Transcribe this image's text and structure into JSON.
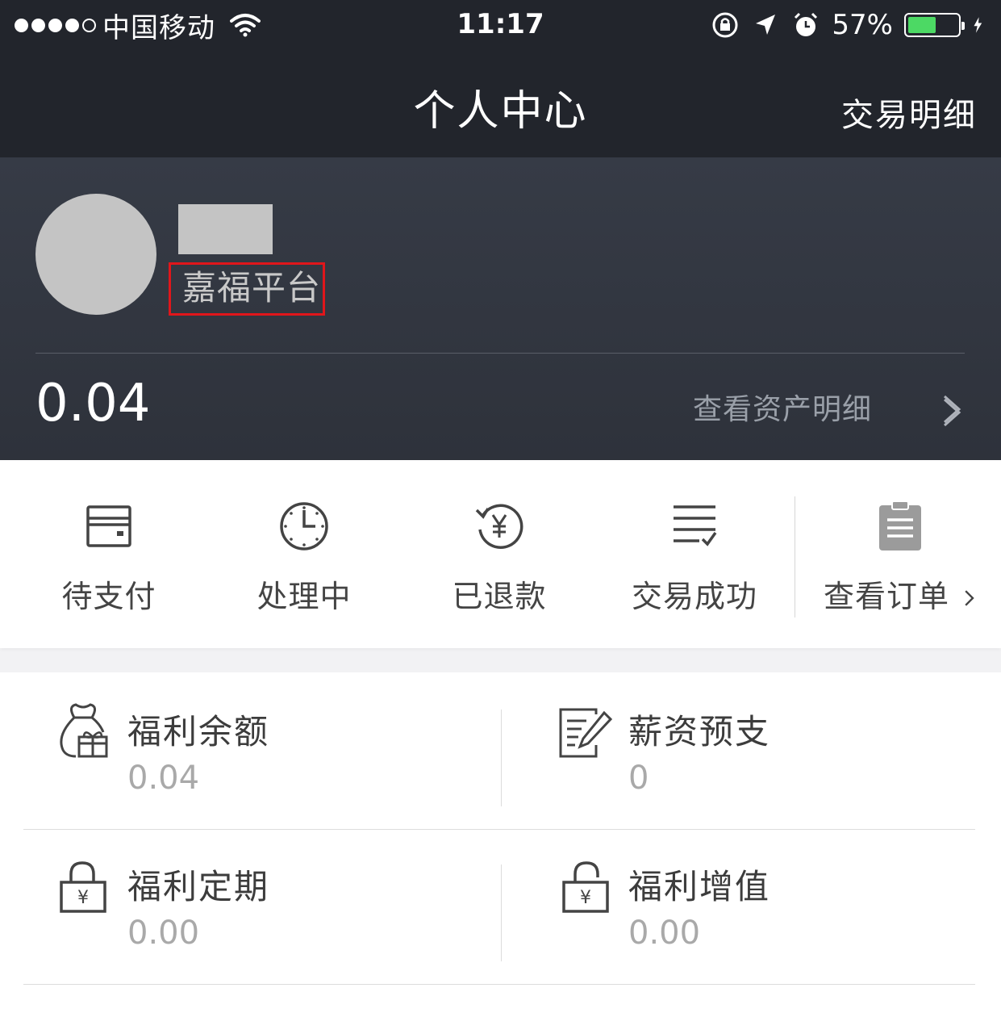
{
  "status_bar": {
    "carrier": "中国移动",
    "time": "11:17",
    "battery_percent": "57%",
    "battery_level": 0.57,
    "icons": [
      "signal-dots",
      "wifi-icon",
      "orientation-lock-icon",
      "location-icon",
      "alarm-icon",
      "battery-icon",
      "charging-icon"
    ]
  },
  "header": {
    "title": "个人中心",
    "right_action": "交易明细"
  },
  "profile": {
    "organization": "嘉福平台",
    "balance": "0.04",
    "asset_link": "查看资产明细"
  },
  "orders": {
    "items": [
      {
        "label": "待支付",
        "icon": "wallet-icon"
      },
      {
        "label": "处理中",
        "icon": "clock-icon"
      },
      {
        "label": "已退款",
        "icon": "refund-icon"
      },
      {
        "label": "交易成功",
        "icon": "list-check-icon"
      }
    ],
    "view_all": "查看订单"
  },
  "assets": [
    {
      "label": "福利余额",
      "value": "0.04",
      "icon": "money-bag-icon"
    },
    {
      "label": "薪资预支",
      "value": "0",
      "icon": "edit-document-icon"
    },
    {
      "label": "福利定期",
      "value": "0.00",
      "icon": "locked-yuan-icon"
    },
    {
      "label": "福利增值",
      "value": "0.00",
      "icon": "unlocked-yuan-icon"
    }
  ],
  "colors": {
    "header_bg": "#22252c",
    "profile_bg": "#333842",
    "highlight_border": "#e0161b",
    "battery_fill": "#4cd964"
  }
}
